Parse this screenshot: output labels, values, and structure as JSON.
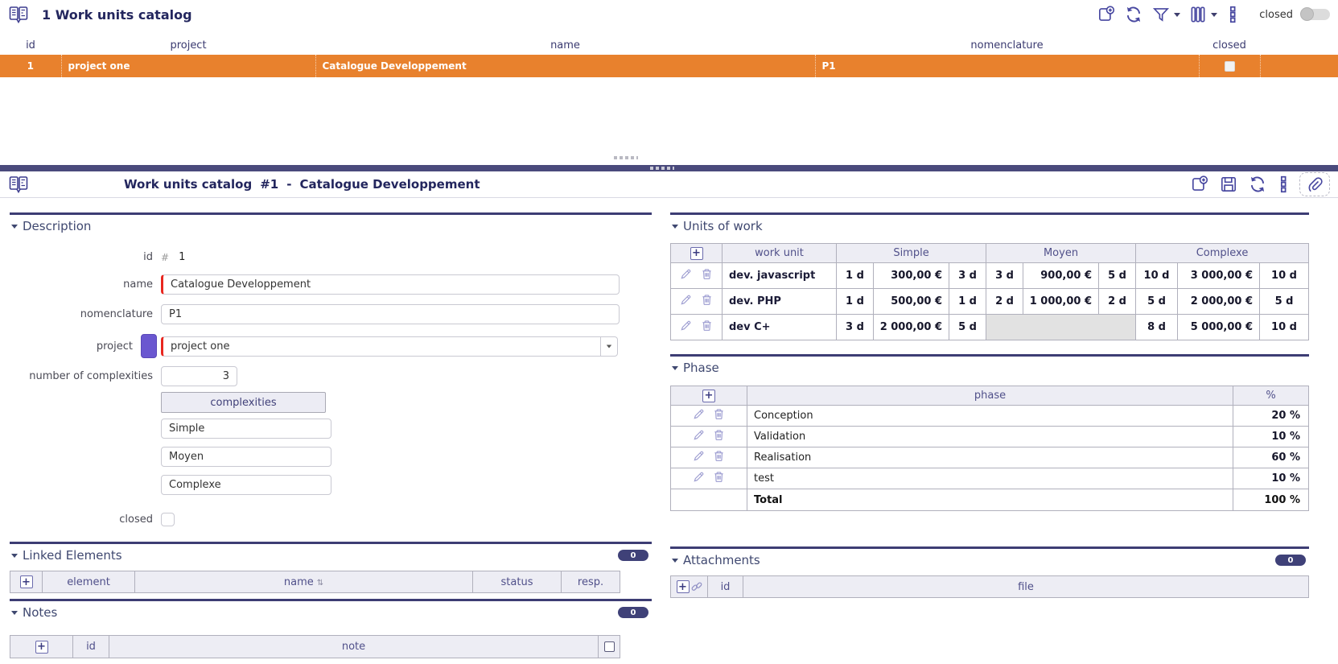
{
  "colors": {
    "accent_navy": "#3d3d74",
    "title_navy": "#23265e",
    "selected_row_orange": "#e8812d",
    "required_red": "#e8271f",
    "project_swatch_purple": "#6a57d0",
    "badge_navy": "#3f4178",
    "table_header_bg": "#ededf4"
  },
  "top_panel": {
    "title": "1 Work units catalog",
    "toolbar": {
      "closed_label": "closed"
    },
    "table": {
      "columns": [
        "id",
        "project",
        "name",
        "nomenclature",
        "closed"
      ],
      "row": {
        "id": "1",
        "project": "project one",
        "name": "Catalogue Developpement",
        "nomenclature": "P1"
      }
    }
  },
  "detail_panel": {
    "title_main": "Work units catalog",
    "title_number": "#1",
    "title_dash": "-",
    "title_name": "Catalogue Developpement"
  },
  "description": {
    "title": "Description",
    "id_label": "id",
    "id_hash": "#",
    "id_value": "1",
    "name_label": "name",
    "name_value": "Catalogue Developpement",
    "nomenclature_label": "nomenclature",
    "nomenclature_value": "P1",
    "project_label": "project",
    "project_value": "project one",
    "count_label": "number of complexities",
    "count_value": "3",
    "complexities_button": "complexities",
    "complexity_1": "Simple",
    "complexity_2": "Moyen",
    "complexity_3": "Complexe",
    "closed_label": "closed"
  },
  "units_of_work": {
    "title": "Units of work",
    "columns": {
      "work_unit": "work unit",
      "simple": "Simple",
      "moyen": "Moyen",
      "complexe": "Complexe"
    },
    "rows": [
      {
        "name": "dev. javascript",
        "simple": [
          "1 d",
          "300,00 €",
          "3 d"
        ],
        "moyen": [
          "3 d",
          "900,00 €",
          "5 d"
        ],
        "complexe": [
          "10 d",
          "3 000,00 €",
          "10 d"
        ]
      },
      {
        "name": "dev. PHP",
        "simple": [
          "1 d",
          "500,00 €",
          "1 d"
        ],
        "moyen": [
          "2 d",
          "1 000,00 €",
          "2 d"
        ],
        "complexe": [
          "5 d",
          "2 000,00 €",
          "5 d"
        ]
      },
      {
        "name": "dev C+",
        "simple": [
          "3 d",
          "2 000,00 €",
          "5 d"
        ],
        "moyen": null,
        "complexe": [
          "8 d",
          "5 000,00 €",
          "10 d"
        ]
      }
    ]
  },
  "phase": {
    "title": "Phase",
    "columns": {
      "phase": "phase",
      "percent": "%"
    },
    "rows": [
      {
        "phase": "Conception",
        "percent": "20 %"
      },
      {
        "phase": "Validation",
        "percent": "10 %"
      },
      {
        "phase": "Realisation",
        "percent": "60 %"
      },
      {
        "phase": "test",
        "percent": "10 %"
      }
    ],
    "total_label": "Total",
    "total_value": "100 %"
  },
  "linked_elements": {
    "title": "Linked Elements",
    "badge": "0",
    "columns": {
      "element": "element",
      "name": "name",
      "status": "status",
      "resp": "resp."
    }
  },
  "attachments": {
    "title": "Attachments",
    "badge": "0",
    "columns": {
      "id": "id",
      "file": "file"
    }
  },
  "notes": {
    "title": "Notes",
    "badge": "0",
    "columns": {
      "id": "id",
      "note": "note"
    }
  }
}
